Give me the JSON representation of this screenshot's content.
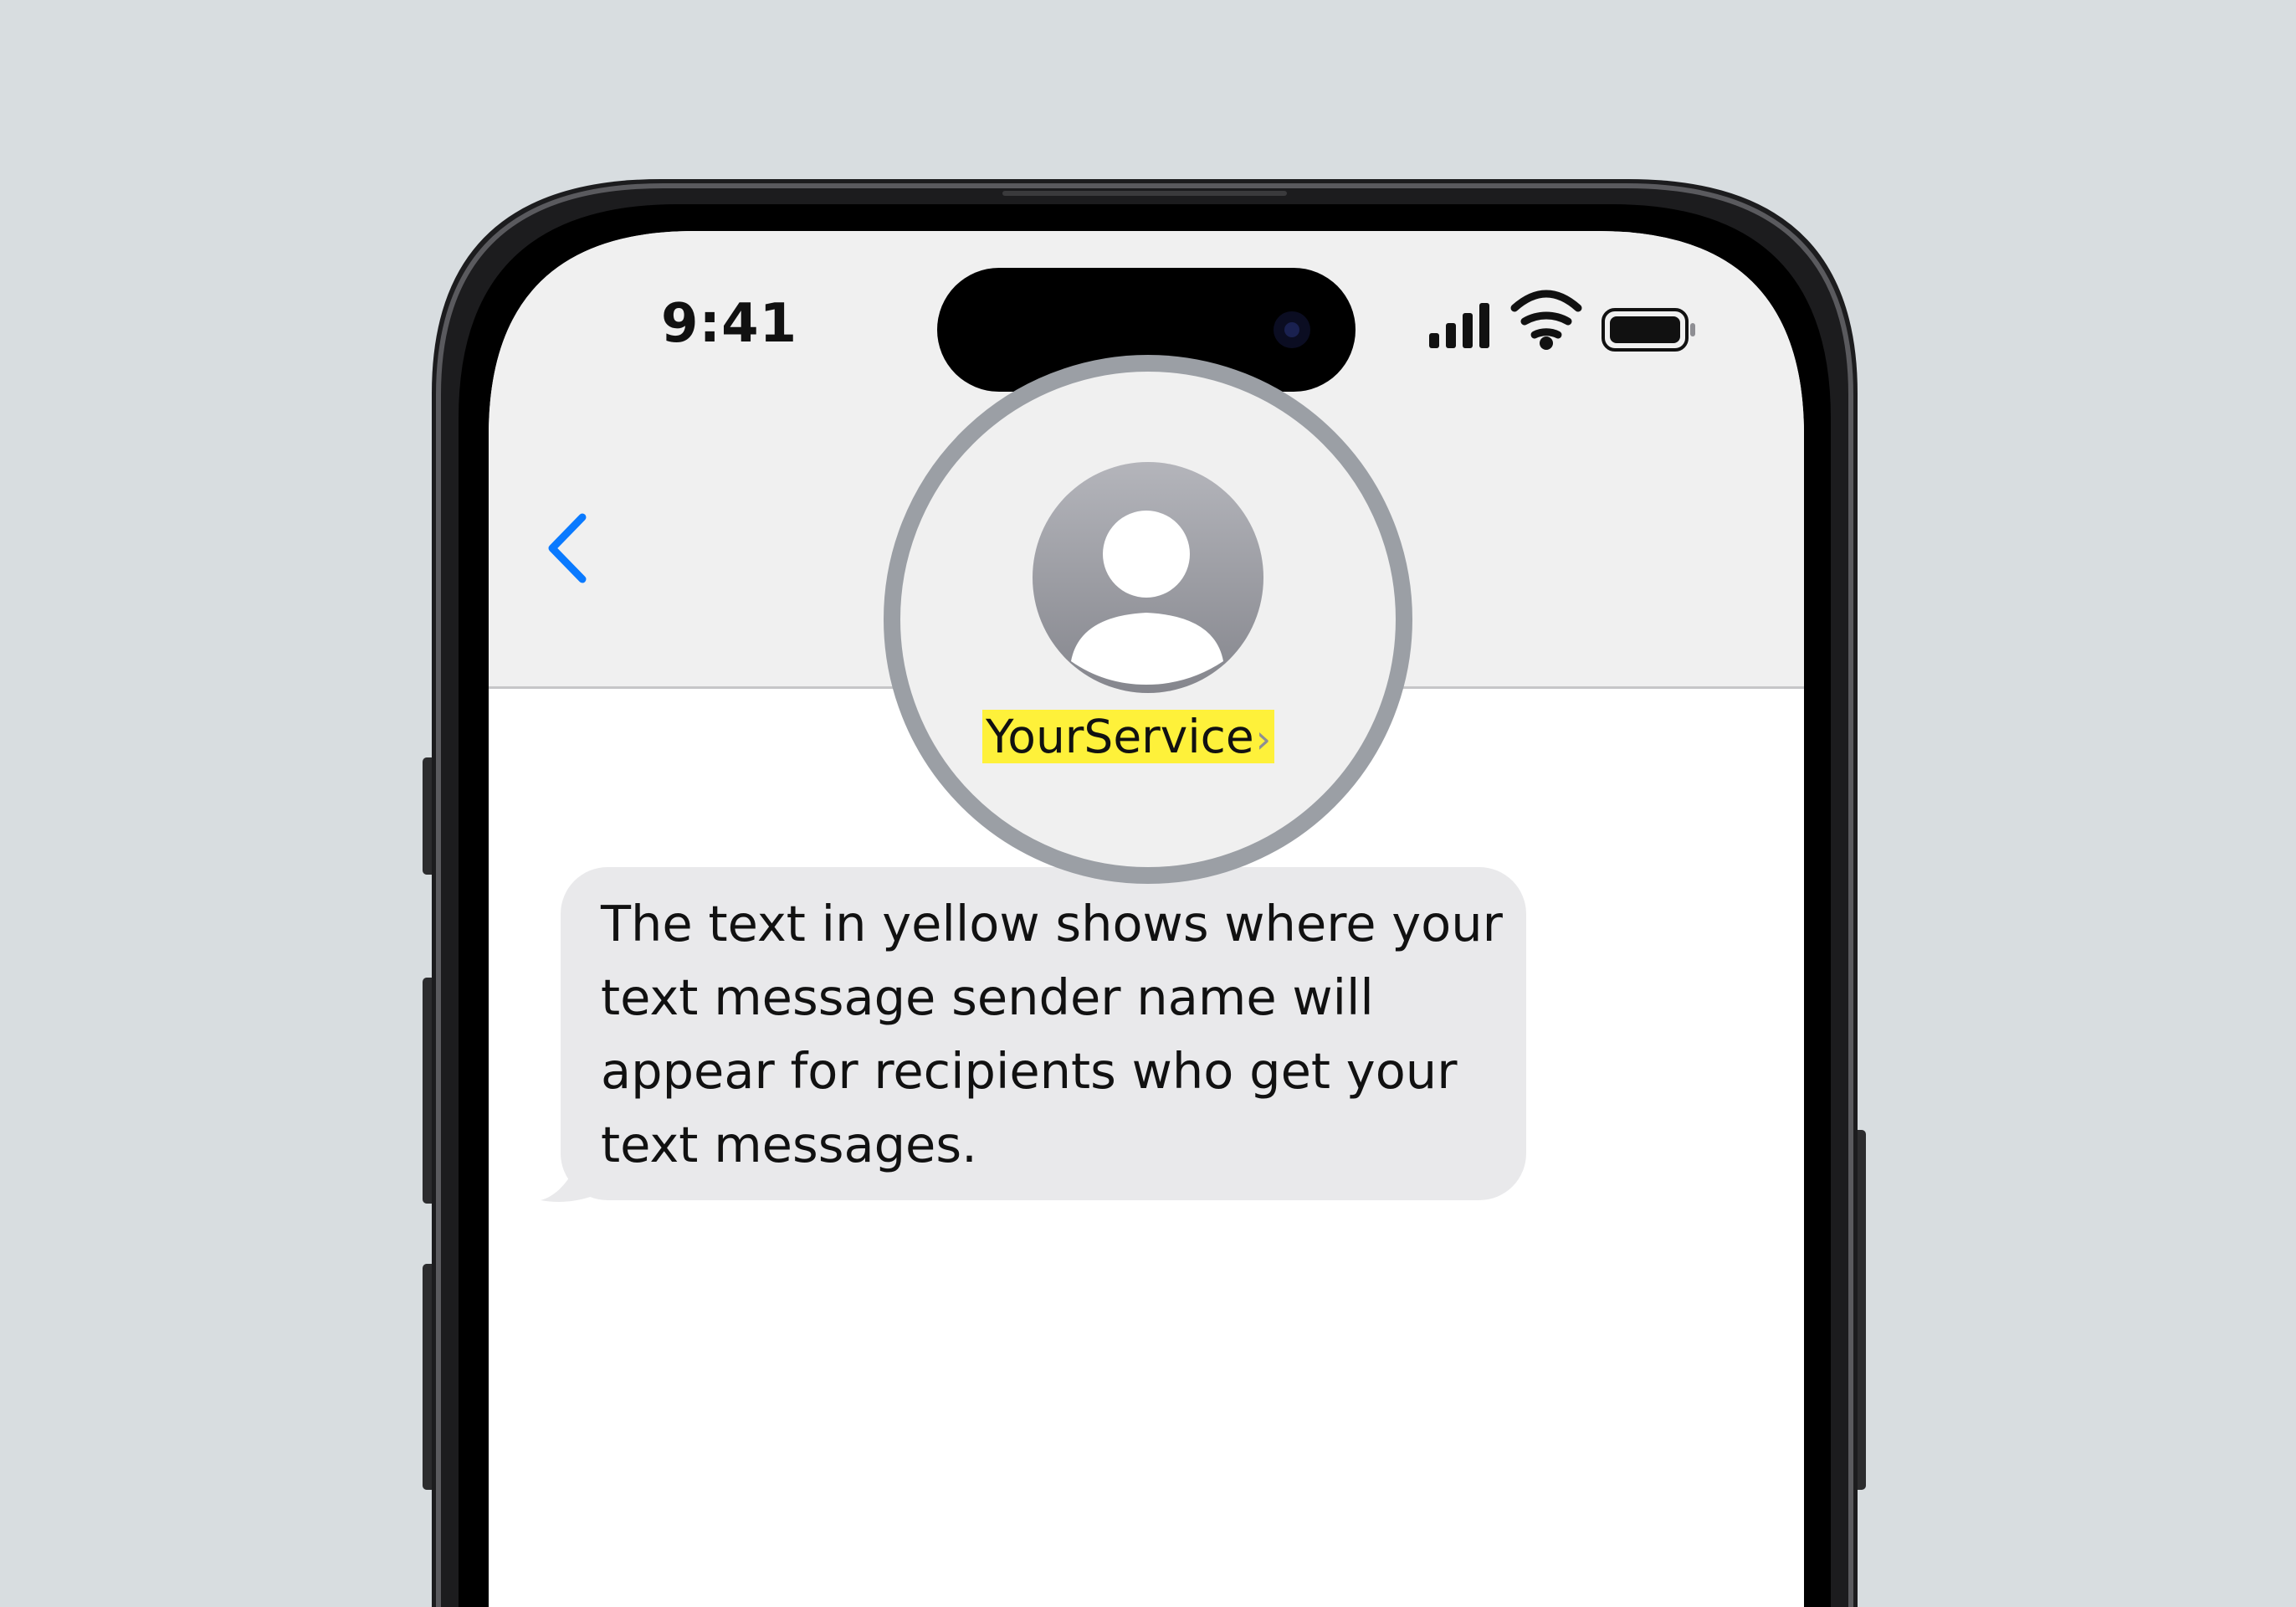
{
  "status_bar": {
    "time": "9:41",
    "icons": [
      "cellular-signal-icon",
      "wifi-icon",
      "battery-icon"
    ]
  },
  "nav": {
    "back_icon": "chevron-left-icon",
    "contact_icon": "person-avatar-icon"
  },
  "contact": {
    "name": "YourService",
    "chevron": "›"
  },
  "message": {
    "text": "The text in yellow shows where your text message sender name will appear for recipients who get your text messages."
  },
  "colors": {
    "background": "#d8dde0",
    "highlight": "#fef13a",
    "accent": "#0a7aff",
    "bubble": "#e9e9eb",
    "header": "#f0f0f0"
  }
}
